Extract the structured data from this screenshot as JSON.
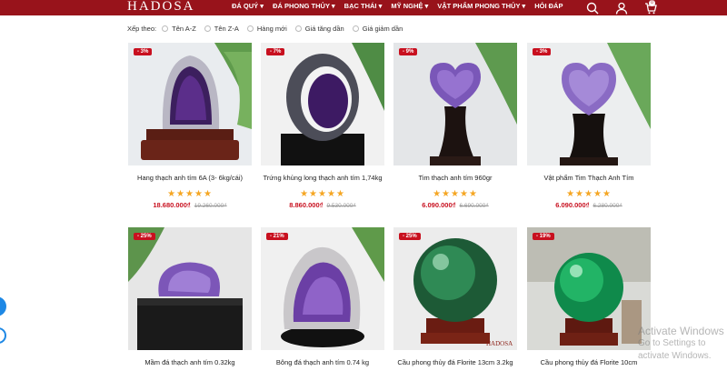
{
  "header": {
    "logo": "HADOSA",
    "nav": [
      {
        "label": "ĐÁ QUÝ ▾"
      },
      {
        "label": "ĐÁ PHONG THỦY ▾"
      },
      {
        "label": "BẠC THÁI ▾"
      },
      {
        "label": "MỸ NGHỆ ▾"
      },
      {
        "label": "VẬT PHẨM PHONG THỦY ▾"
      },
      {
        "label": "HỎI ĐÁP"
      }
    ],
    "icons": [
      "search-icon",
      "user-icon",
      "cart-icon"
    ],
    "cart_count": "0",
    "brand_color": "#98131b"
  },
  "sort": {
    "label": "Xếp theo:",
    "options": [
      "Tên A-Z",
      "Tên Z-A",
      "Hàng mới",
      "Giá tăng dần",
      "Giá giảm dần"
    ]
  },
  "products": [
    {
      "badge": "- 3%",
      "name": "Hang thạch anh tím 6A (3- 6kg/cái)",
      "price": "18.680.000₫",
      "old_price": "19.260.000₫",
      "rating": 5
    },
    {
      "badge": "- 7%",
      "name": "Trứng khủng long thạch anh tím 1,74kg",
      "price": "8.860.000₫",
      "old_price": "9.530.000₫",
      "rating": 5
    },
    {
      "badge": "- 9%",
      "name": "Tim thạch anh tím 960gr",
      "price": "6.090.000₫",
      "old_price": "6.690.000₫",
      "rating": 5
    },
    {
      "badge": "- 3%",
      "name": "Vật phẩm Tim Thạch Anh Tím",
      "price": "6.090.000₫",
      "old_price": "6.280.000₫",
      "rating": 5
    },
    {
      "badge": "- 25%",
      "name": "Mầm đá thạch anh tím 0.32kg",
      "price": "",
      "old_price": "",
      "rating": 0
    },
    {
      "badge": "- 21%",
      "name": "Bông đá thạch anh tím 0.74 kg",
      "price": "",
      "old_price": "",
      "rating": 0
    },
    {
      "badge": "- 25%",
      "name": "Cầu phong thủy đá Florite 13cm 3.2kg",
      "price": "",
      "old_price": "",
      "rating": 0
    },
    {
      "badge": "- 19%",
      "name": "Cầu phong thủy đá Florite 10cm",
      "price": "",
      "old_price": "",
      "rating": 0
    }
  ],
  "stars_text": "★★★★★",
  "watermark": {
    "line1": "Activate Windows",
    "line2": "Go to Settings to activate Windows."
  }
}
